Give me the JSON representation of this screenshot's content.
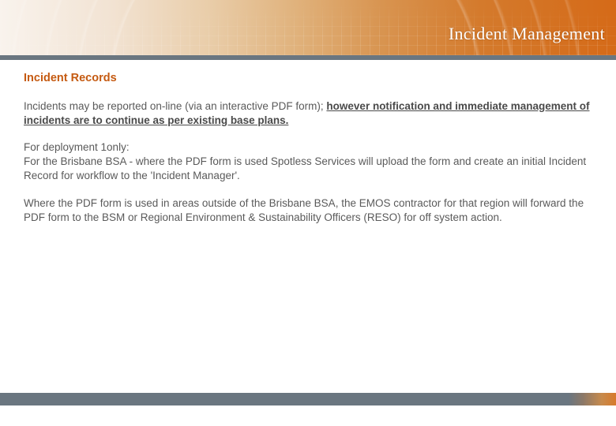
{
  "header": {
    "title": "Incident Management"
  },
  "section": {
    "heading": "Incident Records",
    "p1_a": "Incidents may be reported on-line (via an interactive PDF form); ",
    "p1_b": "however notification and immediate management of incidents are to continue as per existing base plans.",
    "p2_a": "For deployment 1only:",
    "p2_b": "For the Brisbane BSA - where the PDF form is used Spotless Services will upload the form and create an initial Incident Record for workflow to the 'Incident Manager'.",
    "p3": "Where the PDF form is used in areas outside of the Brisbane BSA, the EMOS contractor for that region will forward the PDF form to the BSM or Regional Environment & Sustainability Officers (RESO) for off system action."
  }
}
